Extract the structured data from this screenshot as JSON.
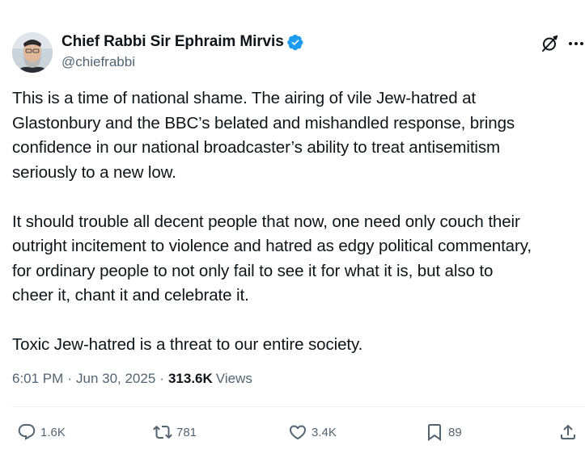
{
  "author": {
    "display_name": "Chief Rabbi Sir Ephraim Mirvis",
    "handle": "@chiefrabbi",
    "verified": true,
    "verified_color": "#1d9bf0"
  },
  "post": {
    "lines": [
      "This is a time of national shame. The airing of vile Jew-hatred at",
      "Glastonbury and the BBC’s belated and mishandled response, brings",
      "confidence in our national broadcaster’s ability to treat antisemitism",
      "seriously to a new low.",
      "",
      "It should trouble all decent people that now, one need only couch their",
      "outright incitement to violence and hatred as edgy political commentary,",
      "for ordinary people to not only fail to see it for what it is, but also to",
      "cheer it, chant it and celebrate it.",
      "",
      "Toxic Jew-hatred is a threat to our entire society."
    ],
    "time": "6:01 PM",
    "date": "Jun 30, 2025",
    "views_count": "313.6K",
    "views_label": "Views"
  },
  "actions": {
    "reply_count": "1.6K",
    "repost_count": "781",
    "like_count": "3.4K",
    "bookmark_count": "89"
  },
  "icons": {
    "avatar": "avatar-photo",
    "verified": "verified-badge-icon",
    "grok": "grok-icon",
    "more": "more-icon",
    "reply": "reply-icon",
    "repost": "repost-icon",
    "like": "heart-icon",
    "bookmark": "bookmark-icon",
    "share": "share-icon"
  },
  "colors": {
    "text_primary": "#0f1419",
    "text_secondary": "#536471",
    "divider": "#eff3f4"
  }
}
